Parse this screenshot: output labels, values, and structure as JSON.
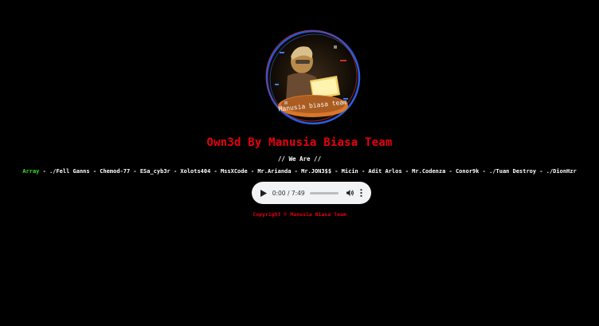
{
  "logo": {
    "text": "Manusia biasa team"
  },
  "title": "Own3d By Manusia Biasa Team",
  "subtitle": "// We Are //",
  "members": {
    "highlight": "Array",
    "list": " - ./Fell Ganns - Chemod-77 - ESa_cyb3r - Xolots404 - MssXCode - Mr.Arianda - Mr.JON3$$ - Micin - Adit Arlos - Mr.Codenza - Conor9k - ./Tuan Destroy - ./DionHzr"
  },
  "audio": {
    "time": "0:00 / 7:49",
    "progress": 0
  },
  "copyright": "Copyright © Manusia Biasa Team",
  "colors": {
    "background": "#000000",
    "accent_red": "#e8000f",
    "highlight_green": "#3bdc2b"
  }
}
